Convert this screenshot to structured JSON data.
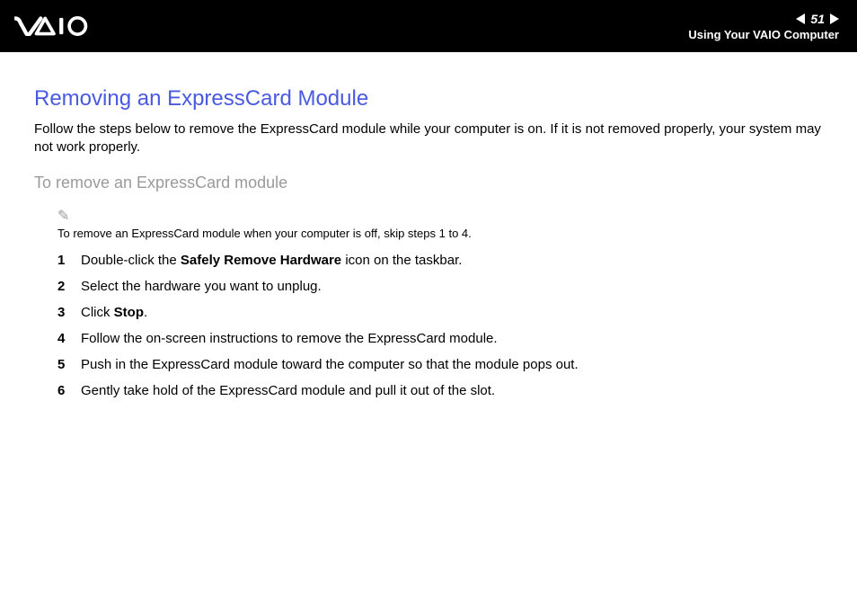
{
  "header": {
    "page_number": "51",
    "section": "Using Your VAIO Computer"
  },
  "content": {
    "title": "Removing an ExpressCard Module",
    "intro": "Follow the steps below to remove the ExpressCard module while your computer is on. If it is not removed properly, your system may not work properly.",
    "subtitle": "To remove an ExpressCard module",
    "note": "To remove an ExpressCard module when your computer is off, skip steps 1 to 4.",
    "steps": [
      {
        "num": "1",
        "pre": "Double-click the ",
        "bold": "Safely Remove Hardware",
        "post": " icon on the taskbar."
      },
      {
        "num": "2",
        "pre": "Select the hardware you want to unplug.",
        "bold": "",
        "post": ""
      },
      {
        "num": "3",
        "pre": "Click ",
        "bold": "Stop",
        "post": "."
      },
      {
        "num": "4",
        "pre": "Follow the on-screen instructions to remove the ExpressCard module.",
        "bold": "",
        "post": ""
      },
      {
        "num": "5",
        "pre": "Push in the ExpressCard module toward the computer so that the module pops out.",
        "bold": "",
        "post": ""
      },
      {
        "num": "6",
        "pre": "Gently take hold of the ExpressCard module and pull it out of the slot.",
        "bold": "",
        "post": ""
      }
    ]
  }
}
